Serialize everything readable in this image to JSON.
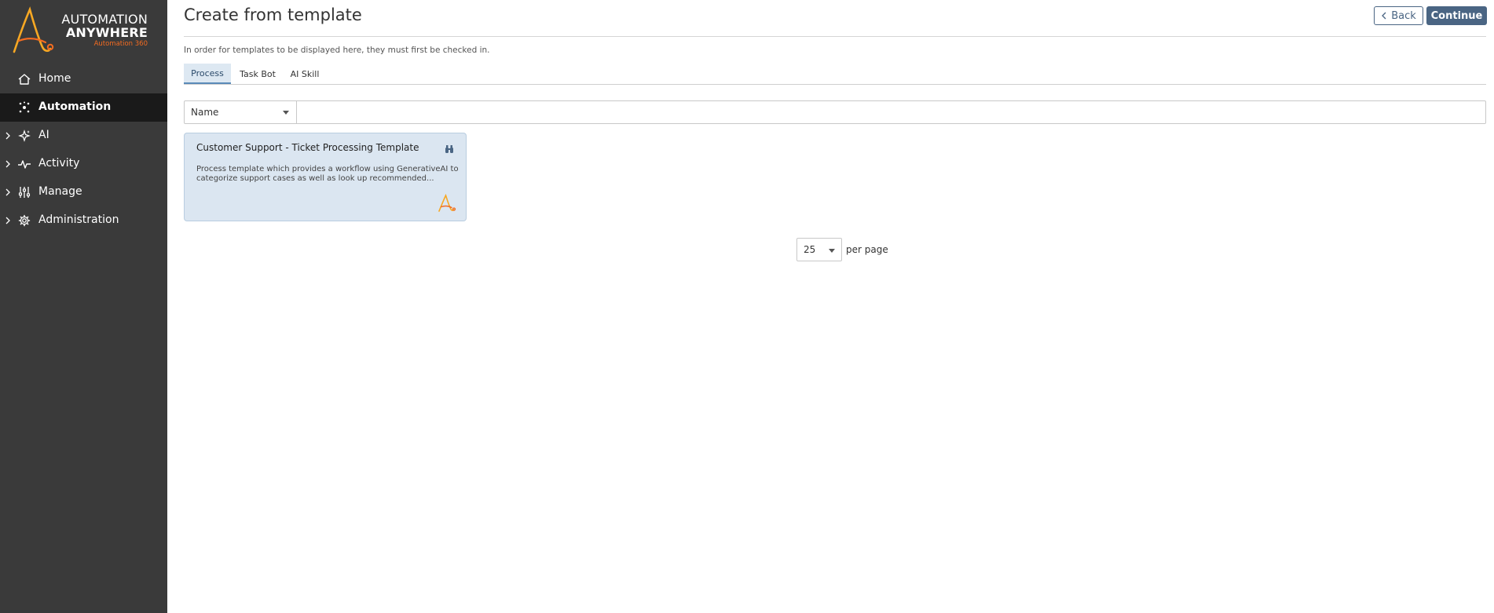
{
  "brand": {
    "line1": "AUTOMATION",
    "line2": "ANYWHERE",
    "line3": "Automation 360",
    "accent_color": "#f26b21"
  },
  "sidebar": {
    "items": [
      {
        "label": "Home",
        "icon": "home-icon",
        "active": false,
        "expandable": false
      },
      {
        "label": "Automation",
        "icon": "automation-icon",
        "active": true,
        "expandable": false
      },
      {
        "label": "AI",
        "icon": "ai-sparkle-icon",
        "active": false,
        "expandable": true
      },
      {
        "label": "Activity",
        "icon": "activity-icon",
        "active": false,
        "expandable": true
      },
      {
        "label": "Manage",
        "icon": "sliders-icon",
        "active": false,
        "expandable": true
      },
      {
        "label": "Administration",
        "icon": "gear-icon",
        "active": false,
        "expandable": true
      }
    ]
  },
  "header": {
    "title": "Create from template",
    "back_label": "Back",
    "continue_label": "Continue"
  },
  "info_text": "In order for templates to be displayed here, they must first be checked in.",
  "tabs": [
    {
      "label": "Process",
      "active": true
    },
    {
      "label": "Task Bot",
      "active": false
    },
    {
      "label": "AI Skill",
      "active": false
    }
  ],
  "filter": {
    "field": "Name",
    "value": ""
  },
  "templates": [
    {
      "title": "Customer Support - Ticket Processing Template",
      "description": "Process template which provides a workflow using GenerativeAI to categorize support cases as well as look up recommended...",
      "icon": "binoculars-icon"
    }
  ],
  "pagination": {
    "per_page": "25",
    "per_page_label": "per page"
  }
}
